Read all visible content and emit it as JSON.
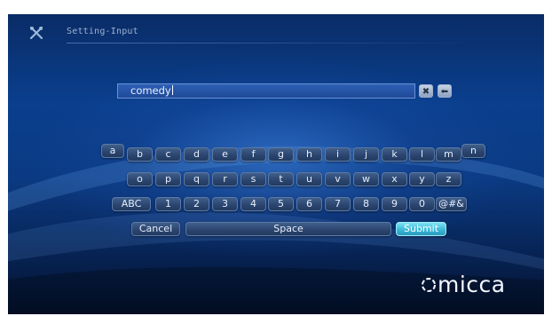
{
  "header": {
    "title": "Setting-Input",
    "icon": "settings-tools-icon"
  },
  "input": {
    "value": "comedy"
  },
  "input_controls": [
    {
      "name": "clear",
      "glyph": "✖",
      "icon": "close-icon"
    },
    {
      "name": "backspace",
      "glyph": "⬅",
      "icon": "backspace-icon"
    }
  ],
  "keyboard": {
    "row1": [
      "a",
      "b",
      "c",
      "d",
      "e",
      "f",
      "g",
      "h",
      "i",
      "j",
      "k",
      "l",
      "m",
      "n"
    ],
    "row2": [
      "o",
      "p",
      "q",
      "r",
      "s",
      "t",
      "u",
      "v",
      "w",
      "x",
      "y",
      "z"
    ],
    "row3": [
      "ABC",
      "1",
      "2",
      "3",
      "4",
      "5",
      "6",
      "7",
      "8",
      "9",
      "0",
      "@#&"
    ],
    "row4": [
      "Cancel",
      "Space",
      "Submit"
    ]
  },
  "brand": {
    "name": "micca"
  },
  "colors": {
    "accent": "#3cb9d8",
    "background": "#0a3f8e",
    "key": "#2c4670"
  }
}
